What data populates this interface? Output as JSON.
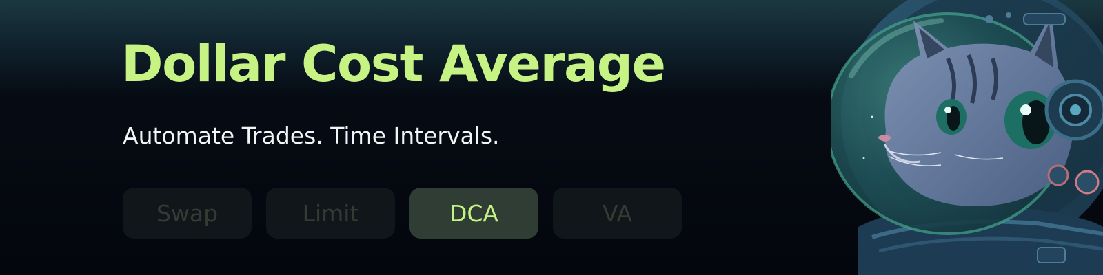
{
  "banner": {
    "title": "Dollar Cost Average",
    "subtitle": "Automate Trades. Time Intervals."
  },
  "tabs": [
    {
      "label": "Swap",
      "active": false
    },
    {
      "label": "Limit",
      "active": false
    },
    {
      "label": "DCA",
      "active": true
    },
    {
      "label": "VA",
      "active": false
    }
  ],
  "illustration": {
    "icon": "astronaut-cat-icon"
  },
  "colors": {
    "accent": "#c7f284",
    "background": "#04060d",
    "tab_inactive_bg": "#11161b",
    "tab_active_bg": "#2f3d35",
    "tab_inactive_text": "#313d33",
    "subtitle": "#f2f4f5"
  }
}
